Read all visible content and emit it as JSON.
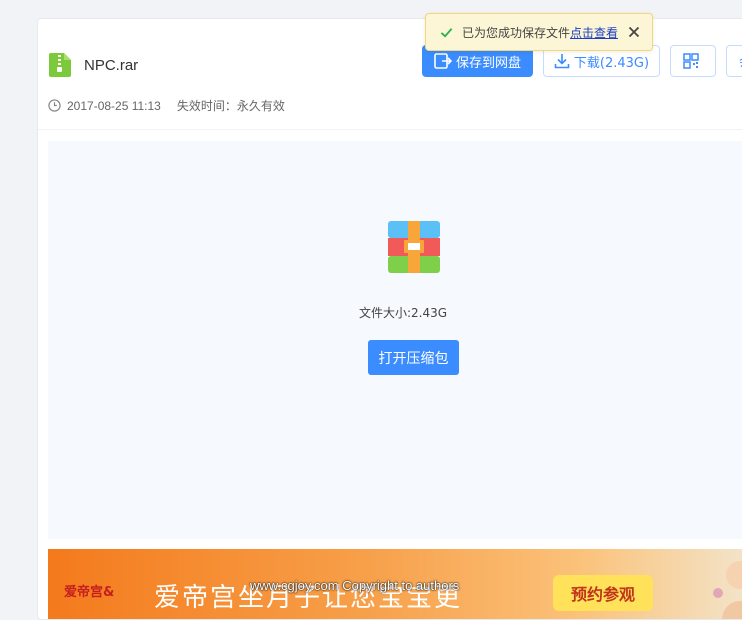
{
  "file": {
    "name": "NPC.rar",
    "date": "2017-08-25 11:13",
    "expire": "失效时间：永久有效",
    "size_label": "文件大小:2.43G"
  },
  "actions": {
    "save_label": "保存到网盘",
    "download_label": "下载(2.43G)",
    "more_label": "会"
  },
  "preview": {
    "open_label": "打开压缩包"
  },
  "toast": {
    "message": "已为您成功保存文件",
    "link": "点击查看"
  },
  "banner": {
    "logo": "爱帝宫&",
    "title": "爱帝宫坐月子让您宝宝更",
    "cta": "预约参观"
  },
  "watermark": "www.cgjoy.com Copyright to authors",
  "colors": {
    "primary": "#3b8cff",
    "file_icon": "#7cc93b",
    "toast_bg": "#fdf6d6",
    "success": "#2bb24c"
  }
}
